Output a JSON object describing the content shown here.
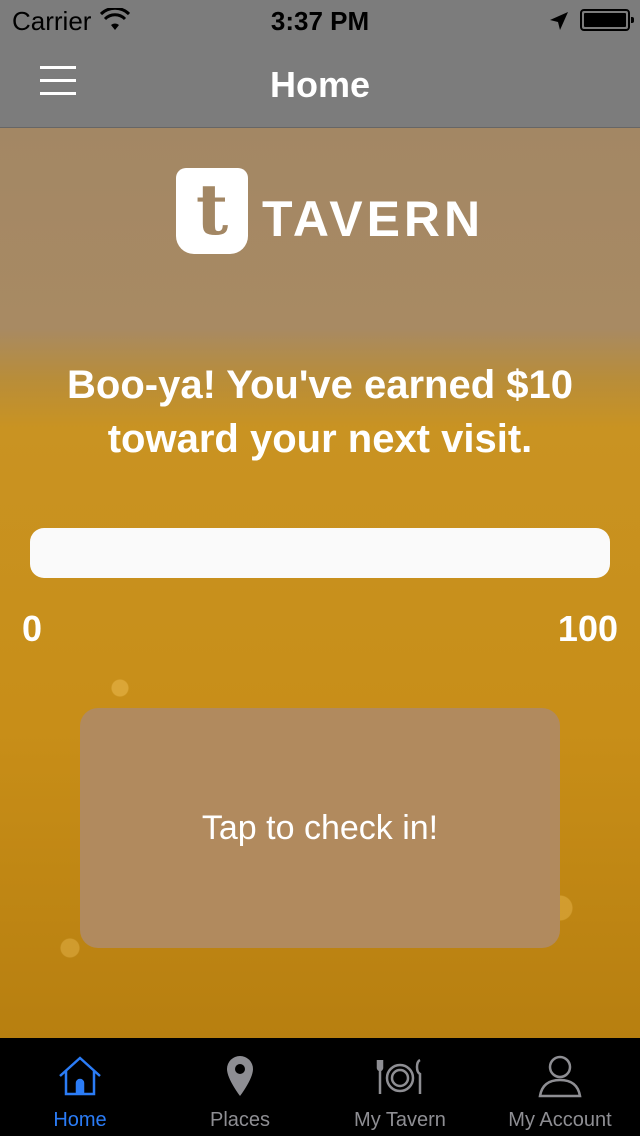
{
  "status_bar": {
    "carrier": "Carrier",
    "time": "3:37 PM"
  },
  "nav": {
    "title": "Home"
  },
  "logo": {
    "badge_letter": "t",
    "text": "TAVERN"
  },
  "message": "Boo-ya! You've earned $10 toward your next visit.",
  "progress": {
    "min_label": "0",
    "max_label": "100",
    "value_fraction": 0
  },
  "checkin_button": {
    "label": "Tap to check in!"
  },
  "tabs": [
    {
      "label": "Home",
      "icon": "home-icon",
      "active": true
    },
    {
      "label": "Places",
      "icon": "map-pin-icon",
      "active": false
    },
    {
      "label": "My Tavern",
      "icon": "plate-cutlery-icon",
      "active": false
    },
    {
      "label": "My Account",
      "icon": "user-icon",
      "active": false
    }
  ],
  "colors": {
    "active_tab": "#2b7cf6",
    "inactive_tab": "#8e8e93",
    "checkin_button": "#b18a5e",
    "nav_bar": "#7c7c7c"
  }
}
